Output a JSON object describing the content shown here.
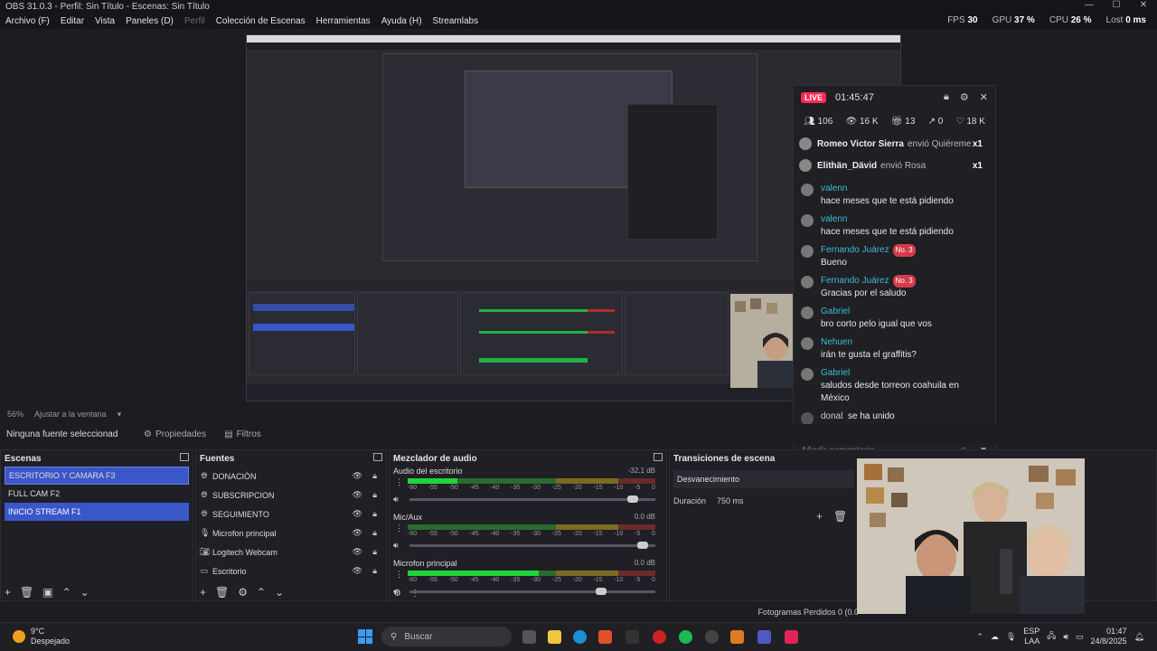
{
  "window": {
    "title": "OBS 31.0.3 - Perfil: Sin Título - Escenas: Sin Título",
    "controls": [
      "—",
      "☐",
      "✕"
    ]
  },
  "menu": [
    {
      "label": "Archivo (F)",
      "dim": false
    },
    {
      "label": "Editar",
      "dim": false
    },
    {
      "label": "Vista",
      "dim": false
    },
    {
      "label": "Paneles (D)",
      "dim": false
    },
    {
      "label": "Perfil",
      "dim": true
    },
    {
      "label": "Colección de Escenas",
      "dim": false
    },
    {
      "label": "Herramientas",
      "dim": false
    },
    {
      "label": "Ayuda (H)",
      "dim": false
    },
    {
      "label": "Streamlabs",
      "dim": false
    }
  ],
  "stats": {
    "fps_label": "FPS",
    "fps": "30",
    "gpu_label": "GPU",
    "gpu": "37 %",
    "cpu_label": "CPU",
    "cpu": "26 %",
    "lost_label": "Lost",
    "lost": "0 ms"
  },
  "live": {
    "badge": "LIVE",
    "time": "01:45:47",
    "stats": [
      "106",
      "16 K",
      "13",
      "0",
      "18 K"
    ],
    "gifts": [
      {
        "user": "Romeo Victor Sierra",
        "action": "envió Quiéreme",
        "count": "x1"
      },
      {
        "user": "Elithän_Dävid",
        "action": "envió Rosa",
        "count": "x1"
      }
    ],
    "messages": [
      {
        "user": "valenn",
        "badge": "",
        "text": "hace meses que te está pidiendo"
      },
      {
        "user": "valenn",
        "badge": "",
        "text": "hace meses que te está pidiendo"
      },
      {
        "user": "Fernando Juárez",
        "badge": "No. 3",
        "text": "Bueno"
      },
      {
        "user": "Fernando Juárez",
        "badge": "No. 3",
        "text": "Gracias por el saludo"
      },
      {
        "user": "Gabriel",
        "badge": "",
        "text": "bro corto pelo igual que vos"
      },
      {
        "user": "Nehuen",
        "badge": "",
        "text": "irán te gusta el graffitis?"
      },
      {
        "user": "Gabriel",
        "badge": "",
        "text": "saludos desde torreon coahuila en México"
      }
    ],
    "joined": {
      "user": "donal",
      "text": "se ha unido"
    },
    "comment_placeholder": "Añadir comentario"
  },
  "zoom": {
    "value": "56%",
    "label": "Ajustar a la ventana"
  },
  "context": {
    "no_source": "Ninguna fuente seleccionad",
    "properties": "Propiedades",
    "filters": "Filtros"
  },
  "scenes": {
    "title": "Escenas",
    "items": [
      "ESCRITORIO Y CAMARA F3",
      "FULL CAM F2",
      "INICIO STREAM F1"
    ]
  },
  "sources": {
    "title": "Fuentes",
    "items": [
      {
        "label": "DONACIÓN",
        "icon": "globe-icon"
      },
      {
        "label": "SUBSCRIPCION",
        "icon": "globe-icon"
      },
      {
        "label": "SEGUIMIENTO",
        "icon": "globe-icon"
      },
      {
        "label": "Microfon principal",
        "icon": "mic-icon"
      },
      {
        "label": "Logitech Webcam",
        "icon": "camera-icon"
      },
      {
        "label": "Escritorio",
        "icon": "monitor-icon"
      }
    ]
  },
  "mixer": {
    "title": "Mezclador de audio",
    "channels": [
      {
        "name": "Audio del escritorio",
        "db": "-32.1 dB",
        "level": 0.2,
        "volume": 0.93
      },
      {
        "name": "Mic/Aux",
        "db": "0.0 dB",
        "level": 0.0,
        "volume": 0.97
      },
      {
        "name": "Microfon principal",
        "db": "0.0 dB",
        "level": 0.53,
        "volume": 0.8
      }
    ],
    "scale": [
      "-60",
      "-55",
      "-50",
      "-45",
      "-40",
      "-35",
      "-30",
      "-25",
      "-20",
      "-15",
      "-10",
      "-5",
      "0"
    ]
  },
  "transitions": {
    "title": "Transiciones de escena",
    "selected": "Desvanecimiento",
    "duration_label": "Duración",
    "duration": "750 ms"
  },
  "status": {
    "frames_lost": "Fotogramas Perdidos 0 (0.0"
  },
  "taskbar": {
    "temp": "9°C",
    "weather": "Despejado",
    "search": "Buscar",
    "lang1": "ESP",
    "lang2": "LAA",
    "time": "01:47",
    "date": "24/8/2025"
  },
  "colors": {
    "accent": "#3a57c9",
    "live": "#fe2c55",
    "meter_green": "#1ed63a"
  }
}
